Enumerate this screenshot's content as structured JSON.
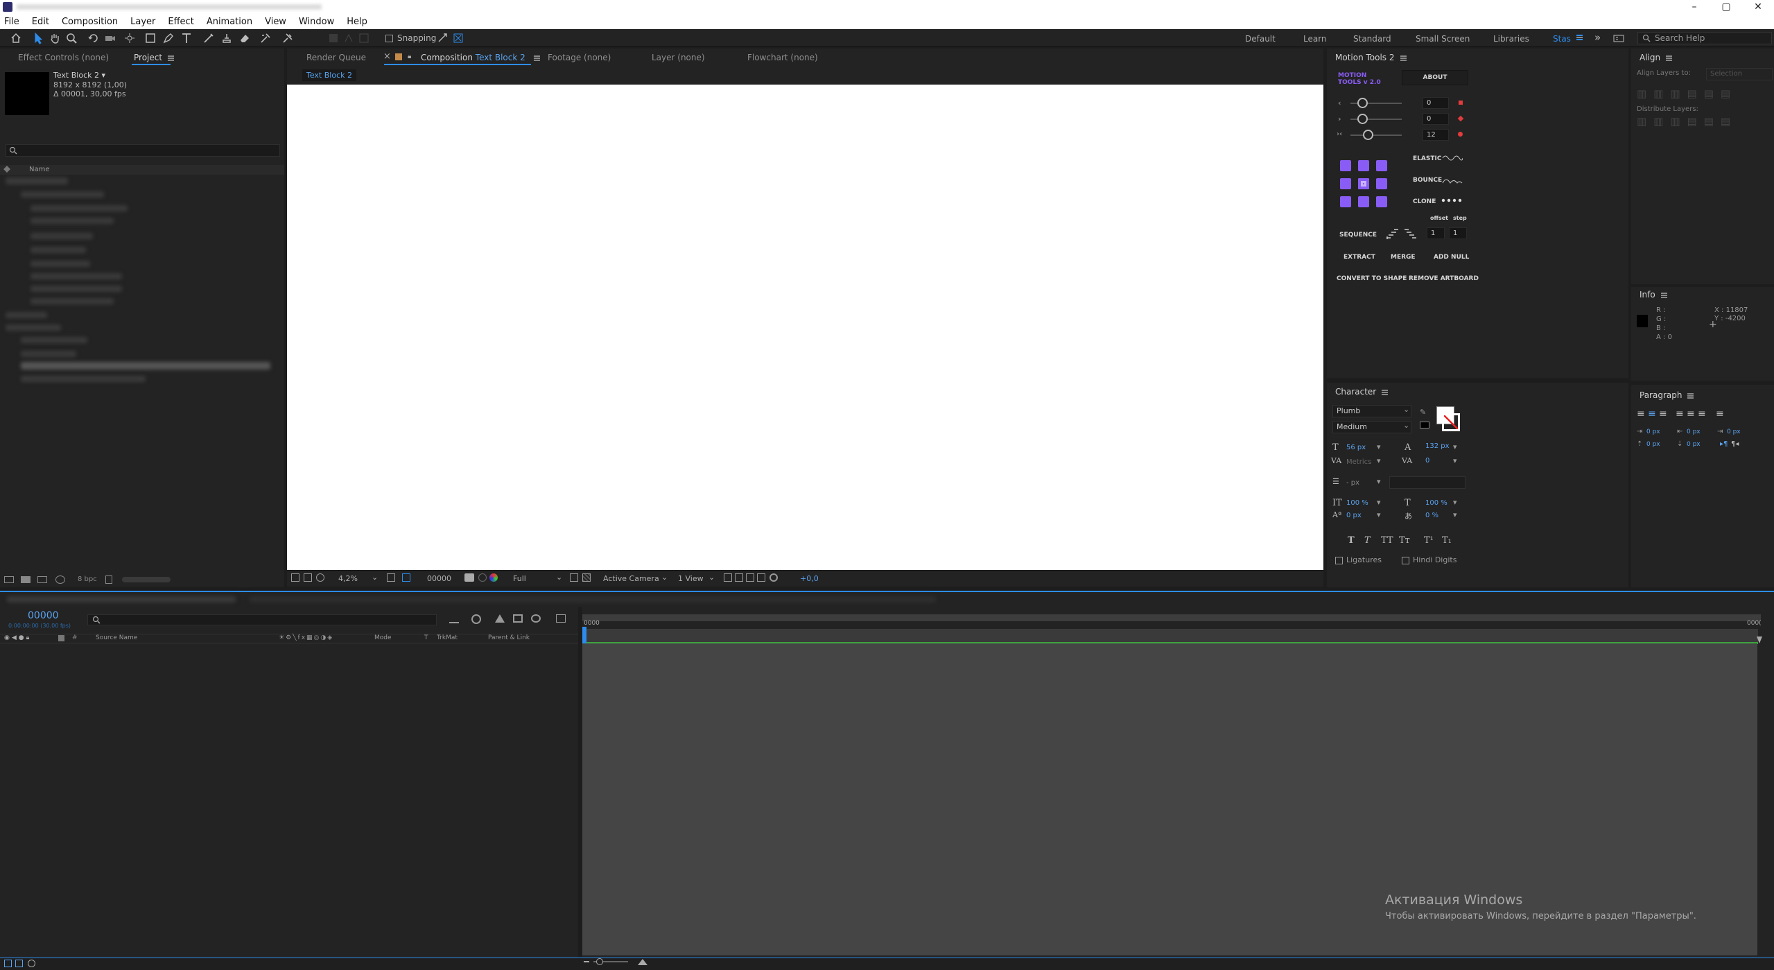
{
  "window": {
    "controls": [
      "–",
      "▢",
      "✕"
    ]
  },
  "menu": [
    "File",
    "Edit",
    "Composition",
    "Layer",
    "Effect",
    "Animation",
    "View",
    "Window",
    "Help"
  ],
  "toolbar": {
    "snapping_label": "Snapping",
    "workspaces": [
      "Default",
      "Learn",
      "Standard",
      "Small Screen",
      "Libraries",
      "Stas"
    ],
    "active_workspace": "Stas",
    "search_placeholder": "Search Help"
  },
  "left_panel": {
    "tabs": [
      "Effect Controls (none)",
      "Project"
    ],
    "comp_name": "Text Block 2 ▾",
    "comp_size": "8192 x 8192 (1,00)",
    "comp_duration": "Δ 00001, 30,00 fps",
    "column_name": "Name",
    "bpc": "8 bpc"
  },
  "viewer": {
    "tabs": {
      "render_queue": "Render Queue",
      "composition_prefix": "Composition",
      "composition_name": "Text Block 2",
      "footage": "Footage (none)",
      "layer": "Layer (none)",
      "flowchart": "Flowchart (none)"
    },
    "breadcrumb": "Text Block 2",
    "zoom": "4,2%",
    "timecode": "00000",
    "resolution": "Full",
    "camera": "Active Camera",
    "views": "1 View",
    "exposure": "+0,0"
  },
  "motion_tools": {
    "title": "Motion Tools 2",
    "logo_line1": "MOTION",
    "logo_line2": "TOOLS v 2.0",
    "about": "ABOUT",
    "slider_values": [
      "0",
      "0",
      "12"
    ],
    "elastic": "ELASTIC",
    "bounce": "BOUNCE",
    "clone": "CLONE",
    "offset_label": "offset",
    "step_label": "step",
    "sequence": "SEQUENCE",
    "offset_value": "1",
    "step_value": "1",
    "extract": "EXTRACT",
    "merge": "MERGE",
    "add_null": "ADD NULL",
    "convert_to_shape": "CONVERT TO SHAPE",
    "remove_artboard": "REMOVE ARTBOARD",
    "accent": "#8a5cf6"
  },
  "align": {
    "title": "Align",
    "align_layers_to": "Align Layers to:",
    "align_target": "Selection",
    "distribute": "Distribute Layers:"
  },
  "info": {
    "title": "Info",
    "r": "R :",
    "g": "G :",
    "b": "B :",
    "a": "A : 0",
    "x": "X : 11807",
    "y": "Y : -4200"
  },
  "character": {
    "title": "Character",
    "font": "Plumb",
    "style": "Medium",
    "font_size": "56 px",
    "leading": "132 px",
    "kerning": "Metrics",
    "tracking": "0",
    "stroke_width": "- px",
    "vscale": "100 %",
    "hscale": "100 %",
    "baseline": "0 px",
    "tsume": "0 %",
    "ligatures": "Ligatures",
    "hindi_digits": "Hindi Digits"
  },
  "paragraph": {
    "title": "Paragraph",
    "indent_values": [
      "0 px",
      "0 px",
      "0 px",
      "0 px",
      "0 px"
    ]
  },
  "timeline": {
    "timecode": "00000",
    "sub_timecode": "0:00:00:00 (30.00 fps)",
    "columns": {
      "source_name": "Source Name",
      "mode": "Mode",
      "t": "T",
      "trkmat": "TrkMat",
      "parent": "Parent & Link"
    },
    "ruler_start": "0000",
    "ruler_end": "000(",
    "work_area_color": "#3fa33f"
  },
  "watermark": {
    "line1": "Активация Windows",
    "line2": "Чтобы активировать Windows, перейдите в раздел \"Параметры\"."
  }
}
